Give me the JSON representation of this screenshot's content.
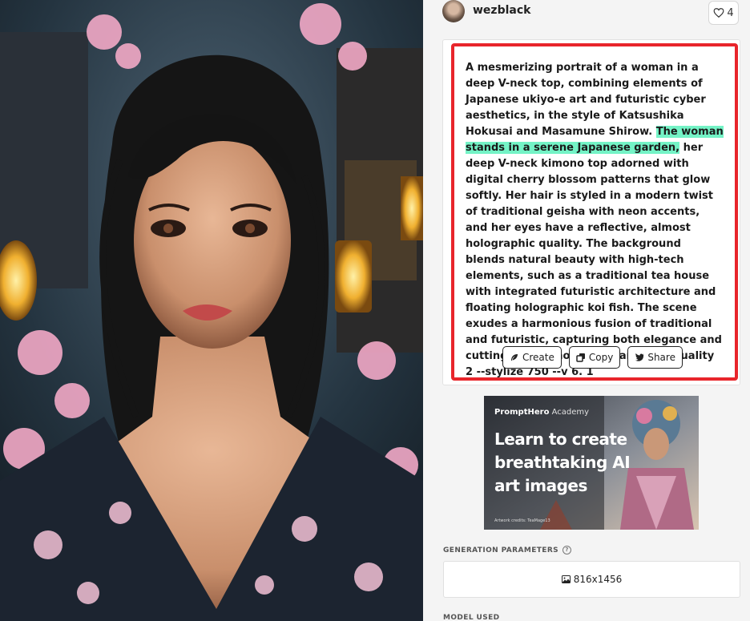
{
  "user": {
    "name": "wezblack",
    "likes": "4"
  },
  "prompt": {
    "before": "A mesmerizing portrait of a woman in a deep V-neck top, combining elements of Japanese ukiyo-e art and futuristic cyber aesthetics, in the style of Katsushika Hokusai and Masamune Shirow. ",
    "highlighted": "The woman stands in a serene Japanese garden,",
    "after": " her deep V-neck kimono top adorned with digital cherry blossom patterns that glow softly. Her hair is styled in a modern twist of traditional geisha with neon accents, and her eyes have a reflective, almost holographic quality. The background blends natural beauty with high-tech elements, such as a traditional tea house with integrated futuristic architecture and floating holographic koi fish. The scene exudes a harmonious fusion of traditional and futuristic, capturing both elegance and cutting-edge innovation --ar 9:16 --quality 2 --stylize 750 --v 6. 1"
  },
  "actions": {
    "create": "Create",
    "copy": "Copy",
    "share": "Share"
  },
  "promo": {
    "brand": "PromptHero",
    "brand_suffix": " Academy",
    "headline": "Learn to create breathtaking AI art images",
    "credit": "Artwork credits: TeaMage13"
  },
  "sections": {
    "generation_parameters": "GENERATION PARAMETERS",
    "help_glyph": "?",
    "dimensions": "816x1456",
    "model_used": "MODEL USED"
  },
  "colors": {
    "highlight": "#74f3c6",
    "outline": "#e8252b"
  },
  "icons": [
    "heart-icon",
    "feather-icon",
    "copy-icon",
    "twitter-icon",
    "image-icon",
    "help-icon"
  ]
}
